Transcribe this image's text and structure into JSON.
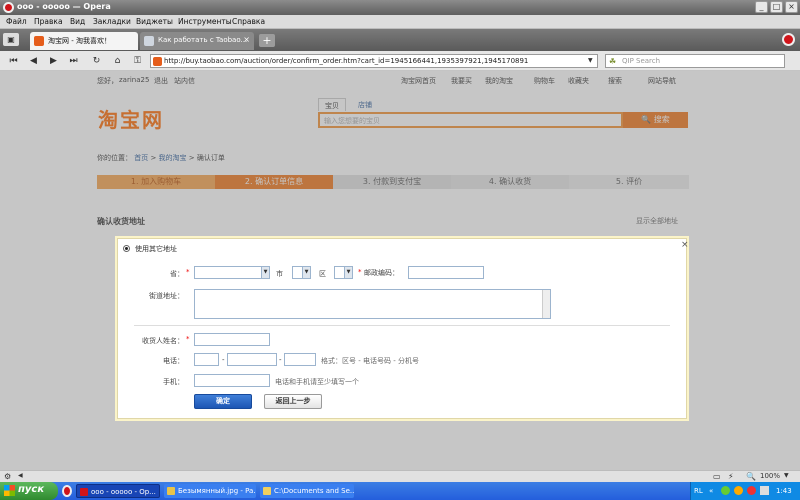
{
  "window": {
    "title": "ооо - ооооо — Opera"
  },
  "menu": [
    "Файл",
    "Правка",
    "Вид",
    "Закладки",
    "Виджеты",
    "Инструменты",
    "Справка"
  ],
  "tabs": [
    {
      "label": "淘宝网 - 淘我喜欢！",
      "active": true
    },
    {
      "label": "Как работать с Taobao...",
      "active": false
    }
  ],
  "addressbar": {
    "url": "http://buy.taobao.com/auction/order/confirm_order.htm?cart_id=1945166441,1935397921,1945170891",
    "search_placeholder": "QIP Search"
  },
  "site": {
    "greeting": "您好，",
    "username": "zarina25",
    "logout": "退出",
    "messages": "站内信",
    "toplinks": [
      "淘宝网首页",
      "我要买",
      "我的淘宝",
      "购物车",
      "收藏夹",
      "搜索",
      "网站导航"
    ],
    "logo": "淘宝网",
    "search_tabs": [
      "宝贝",
      "店铺"
    ],
    "search_placeholder": "输入您想要的宝贝",
    "search_button": "搜索",
    "breadcrumb": {
      "prefix": "你的位置：",
      "home": "首页",
      "my": "我的淘宝",
      "current": "确认订单"
    },
    "steps": [
      "1. 加入购物车",
      "2. 确认订单信息",
      "3. 付款到支付宝",
      "4. 确认收货",
      "5. 评价"
    ],
    "address_heading": "确认收货地址",
    "show_all": "显示全部地址"
  },
  "modal": {
    "radio_label": "使用其它地址",
    "province_label": "省：",
    "city_label": "市",
    "district_label": "区",
    "zip_label": "邮政编码：",
    "street_label": "街道地址：",
    "name_label": "收货人姓名：",
    "phone_label": "电话：",
    "phone_hint": "格式：区号 - 电话号码 - 分机号",
    "mobile_label": "手机：",
    "mobile_hint": "电话和手机请至少填写一个",
    "confirm_button": "确定",
    "back_button": "返回上一步",
    "required_mark": "*",
    "close": "×"
  },
  "statusbar": {
    "zoom": "100%"
  },
  "taskbar": {
    "start": "пуск",
    "tasks": [
      "ооо - ооооо - Ор...",
      "Безымянный.jpg - Pa...",
      "C:\\Documents and Se..."
    ],
    "lang": "RL",
    "time": "1:43"
  }
}
